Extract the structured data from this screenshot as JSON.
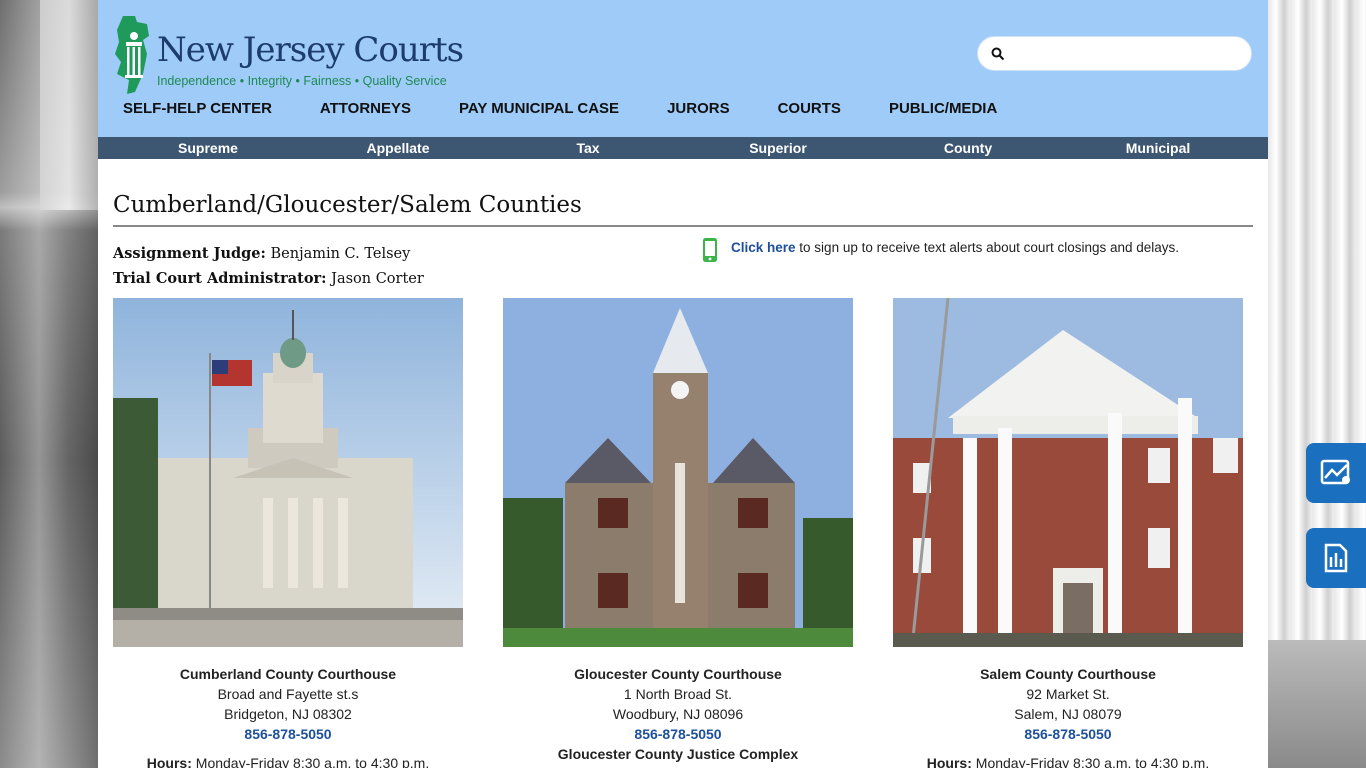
{
  "header": {
    "logo_title": "New Jersey Courts",
    "logo_tagline": "Independence • Integrity • Fairness • Quality Service",
    "search_placeholder": ""
  },
  "main_nav": [
    "SELF-HELP CENTER",
    "ATTORNEYS",
    "PAY MUNICIPAL CASE",
    "JURORS",
    "COURTS",
    "PUBLIC/MEDIA"
  ],
  "sub_nav": [
    "Supreme",
    "Appellate",
    "Tax",
    "Superior",
    "County",
    "Municipal"
  ],
  "page": {
    "title": "Cumberland/Gloucester/Salem Counties",
    "assignment_judge_label": "Assignment Judge:",
    "assignment_judge": "Benjamin C. Telsey",
    "tca_label": "Trial Court Administrator:",
    "tca": "Jason Corter",
    "alert_link": "Click here",
    "alert_text": " to sign up to receive text alerts about court closings and delays."
  },
  "courthouses": [
    {
      "name": "Cumberland County Courthouse",
      "address1": "Broad and Fayette st.s",
      "address2": "Bridgeton, NJ 08302",
      "phone": "856-878-5050",
      "hours_label": "Hours:",
      "hours": "Monday-Friday 8:30 a.m. to 4:30 p.m."
    },
    {
      "name": "Gloucester County Courthouse",
      "address1": "1 North Broad St.",
      "address2": "Woodbury, NJ 08096",
      "phone": "856-878-5050",
      "extra": "Gloucester County Justice Complex"
    },
    {
      "name": "Salem County Courthouse",
      "address1": "92 Market St.",
      "address2": "Salem, NJ 08079",
      "phone": "856-878-5050",
      "hours_label": "Hours:",
      "hours": "Monday-Friday 8:30 a.m. to 4:30 p.m."
    }
  ],
  "colors": {
    "header_bg": "#9ecbf7",
    "subnav_bg": "#3d5671",
    "link": "#1d4f9c",
    "side_button": "#1a6fbf"
  }
}
